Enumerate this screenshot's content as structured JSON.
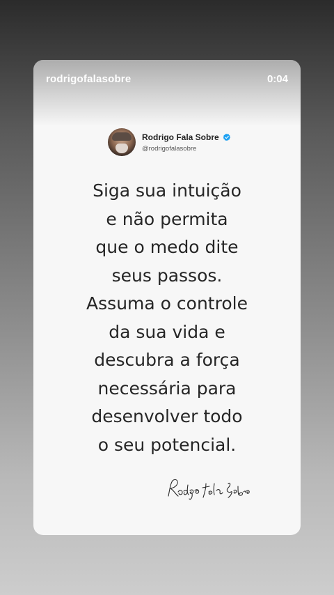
{
  "story": {
    "username": "rodrigofalasobre",
    "timer": "0:04"
  },
  "profile": {
    "name": "Rodrigo Fala Sobre",
    "handle": "@rodrigofalasobre",
    "verified": true
  },
  "quote": {
    "lines": [
      "Siga sua intuição",
      "e não permita",
      "que o medo dite",
      "seus passos.",
      "Assuma o controle",
      "da sua vida e",
      "descubra a força",
      "necessária para",
      "desenvolver todo",
      "o seu potencial."
    ]
  },
  "signature": {
    "text": "Rodrigo Fala Sobre"
  },
  "colors": {
    "verified": "#1da1f2",
    "card": "#f7f7f7",
    "text": "#262626"
  }
}
